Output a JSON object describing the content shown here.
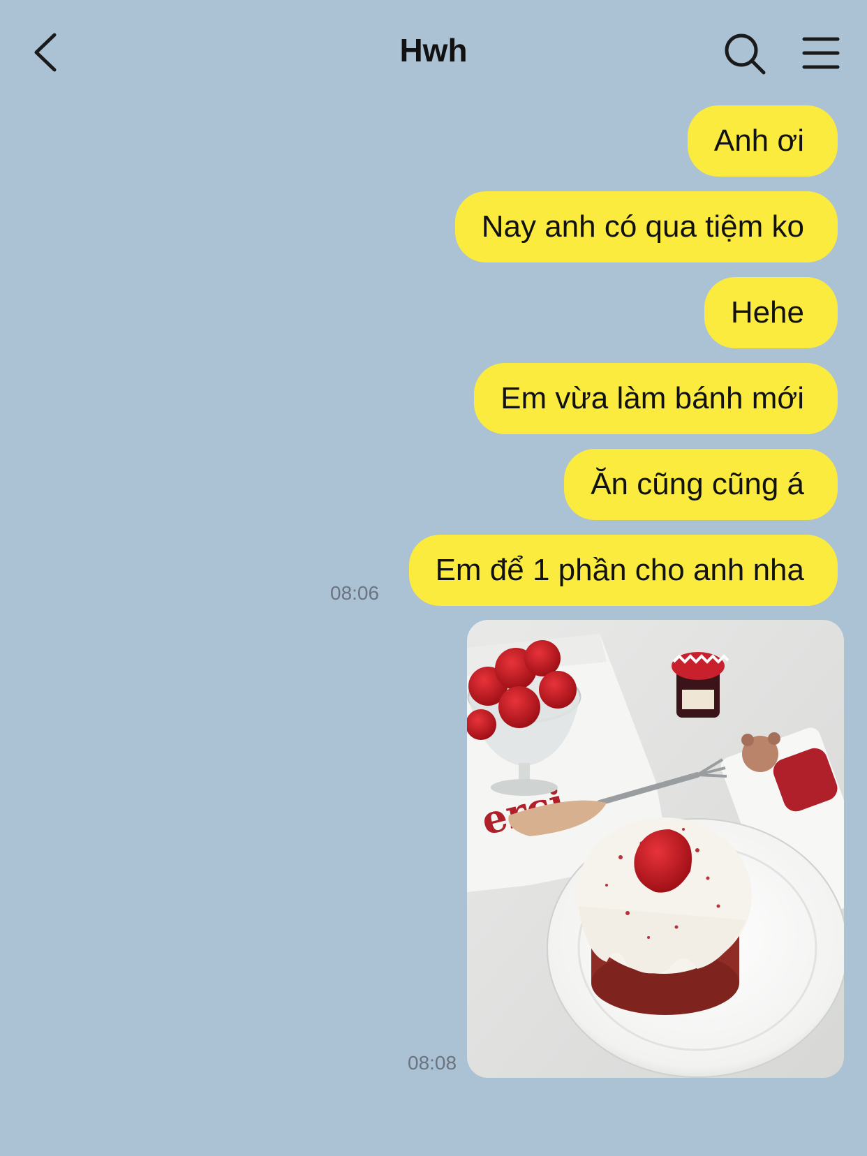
{
  "header": {
    "title": "Hwh",
    "back_icon": "chevron-left-icon",
    "search_icon": "search-icon",
    "menu_icon": "hamburger-menu-icon"
  },
  "messages": [
    {
      "text": "Anh ơi"
    },
    {
      "text": "Nay anh có qua tiệm ko"
    },
    {
      "text": "Hehe"
    },
    {
      "text": "Em vừa làm bánh mới"
    },
    {
      "text": "Ăn cũng cũng á"
    },
    {
      "text": "Em để 1 phần cho anh nha",
      "time": "08:06"
    }
  ],
  "photo_message": {
    "time": "08:08",
    "napkin_text": "erci"
  },
  "colors": {
    "background": "#abc1d4",
    "bubble": "#fbeb3f",
    "text": "#111111",
    "timestamp": "#6b7480"
  }
}
